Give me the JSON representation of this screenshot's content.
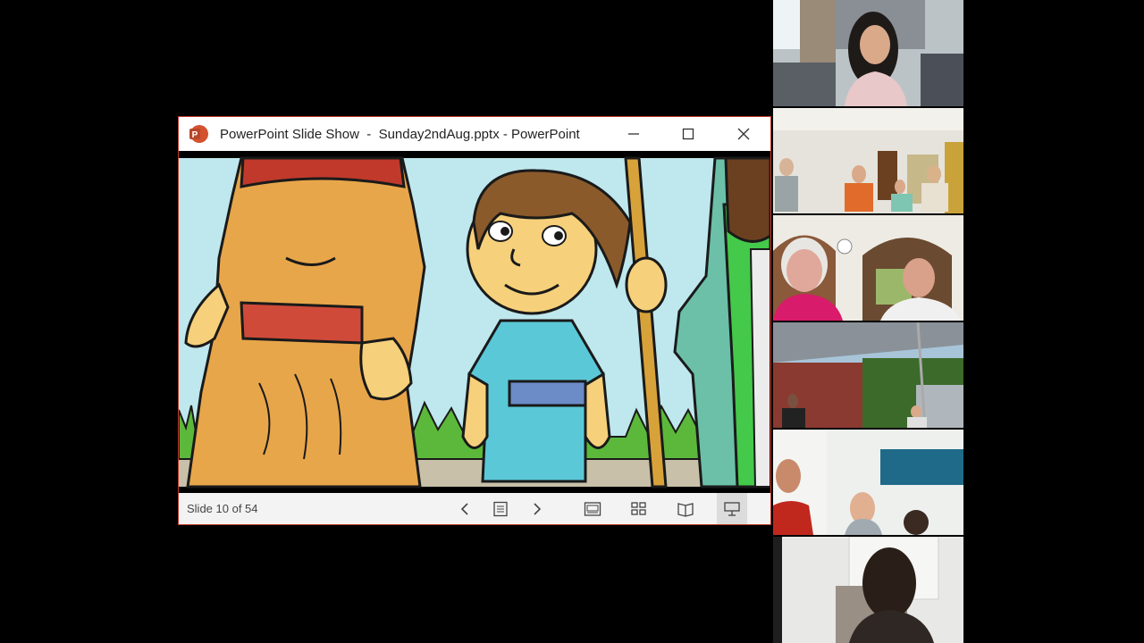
{
  "window": {
    "title": "PowerPoint Slide Show  -  Sunday2ndAug.pptx - PowerPoint",
    "app_icon_letter": "P",
    "accent": "#c43e1c"
  },
  "statusbar": {
    "slide_counter": "Slide 10 of 54"
  },
  "participants": [
    {
      "tile": "participant-tile-1"
    },
    {
      "tile": "participant-tile-2"
    },
    {
      "tile": "participant-tile-3"
    },
    {
      "tile": "participant-tile-4"
    },
    {
      "tile": "participant-tile-5"
    },
    {
      "tile": "participant-tile-6"
    }
  ]
}
